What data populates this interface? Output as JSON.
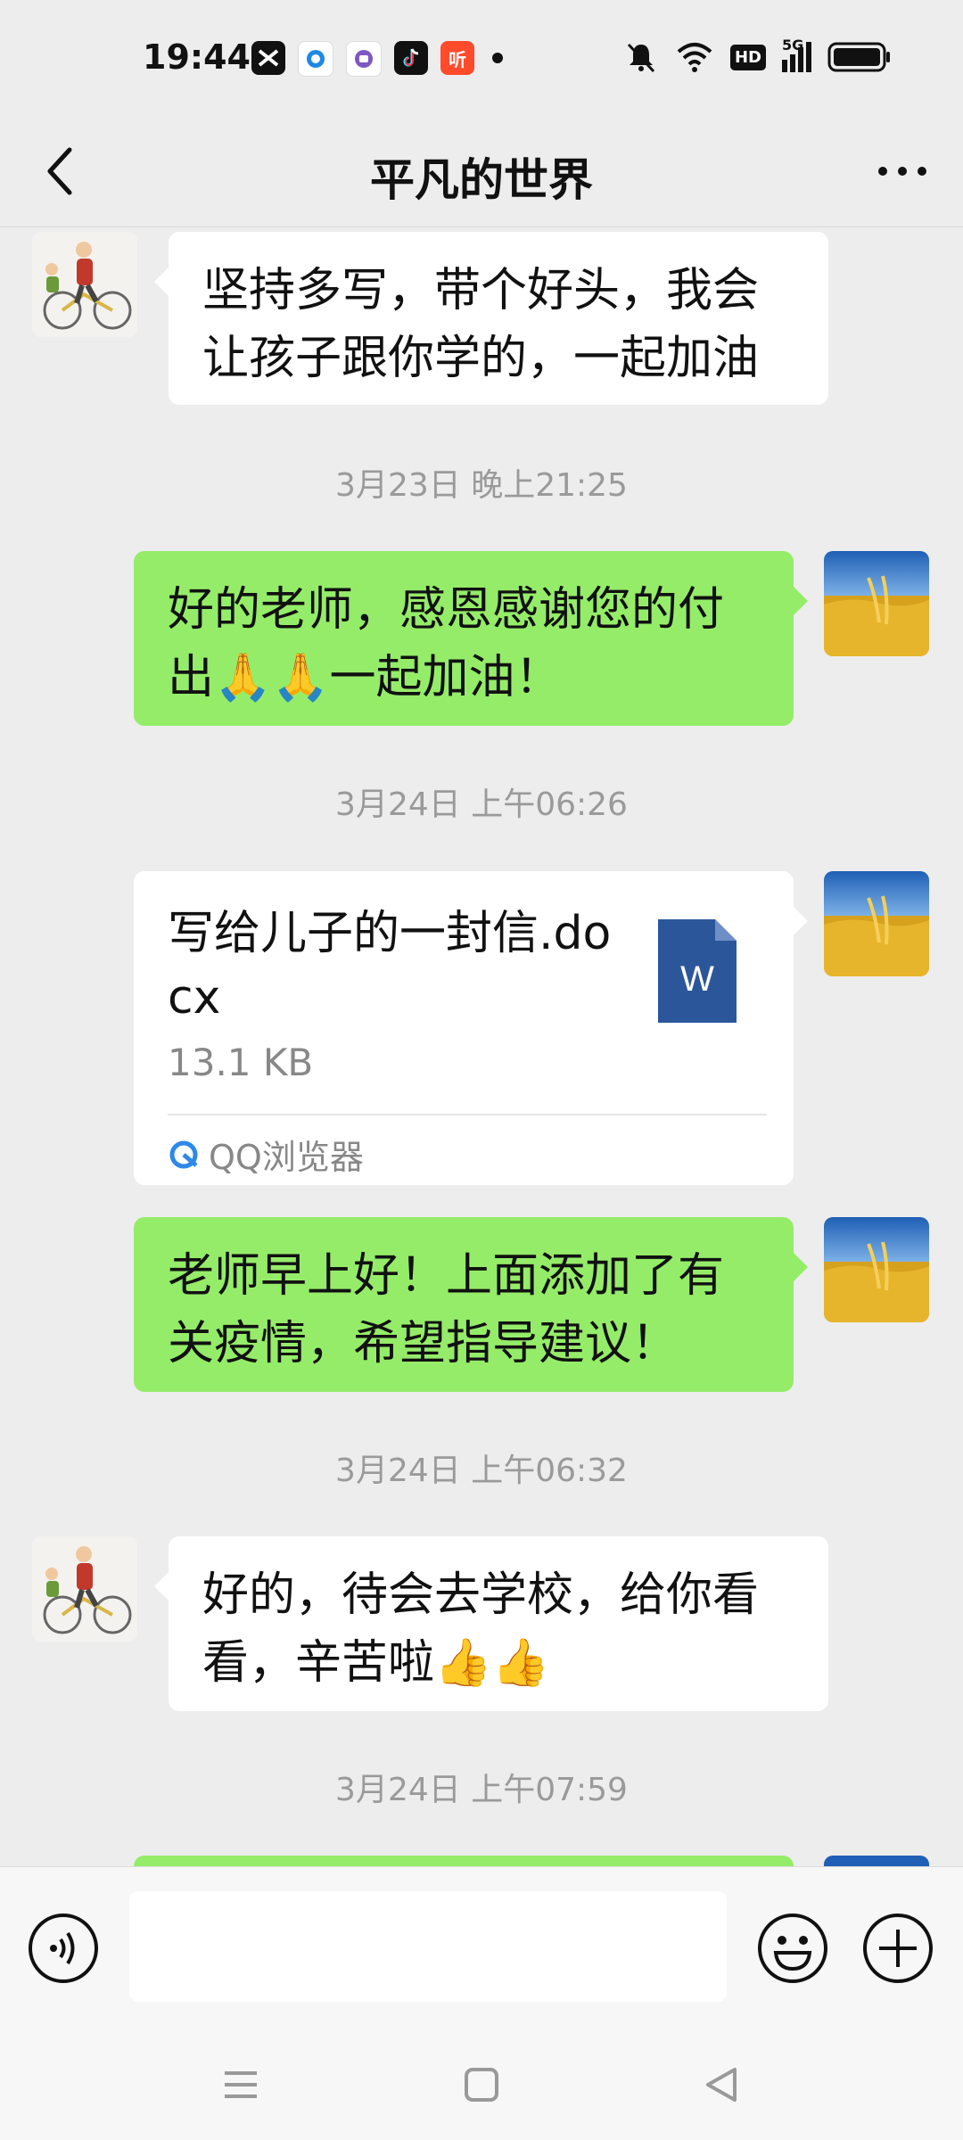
{
  "status": {
    "time": "19:44",
    "notification_icons": [
      "capcut-icon",
      "browser-icon",
      "app-icon",
      "tiktok-icon",
      "listen-app-icon"
    ],
    "listen_label": "听",
    "hd_label": "HD",
    "net_label": "5G"
  },
  "header": {
    "title": "平凡的世界"
  },
  "messages": [
    {
      "side": "left",
      "text": "坚持多写，带个好头，我会让孩子跟你学的，一起加油"
    },
    {
      "timestamp": "3月23日 晚上21:25"
    },
    {
      "side": "right",
      "text": "好的老师，感恩感谢您的付出🙏🙏一起加油！"
    },
    {
      "timestamp": "3月24日 上午06:26"
    },
    {
      "side": "right",
      "type": "file",
      "file_name": "写给儿子的一封信.docx",
      "file_size": "13.1 KB",
      "source": "QQ浏览器",
      "icon_letter": "W"
    },
    {
      "side": "right",
      "text": "老师早上好！上面添加了有关疫情，希望指导建议！"
    },
    {
      "timestamp": "3月24日 上午06:32"
    },
    {
      "side": "left",
      "text": "好的，待会去学校，给你看看，辛苦啦👍👍"
    },
    {
      "timestamp": "3月24日 上午07:59"
    }
  ],
  "input": {
    "value": "",
    "placeholder": ""
  },
  "colors": {
    "background": "#ededed",
    "sent_bubble": "#95ec69",
    "received_bubble": "#ffffff",
    "word_blue": "#2b579a"
  }
}
